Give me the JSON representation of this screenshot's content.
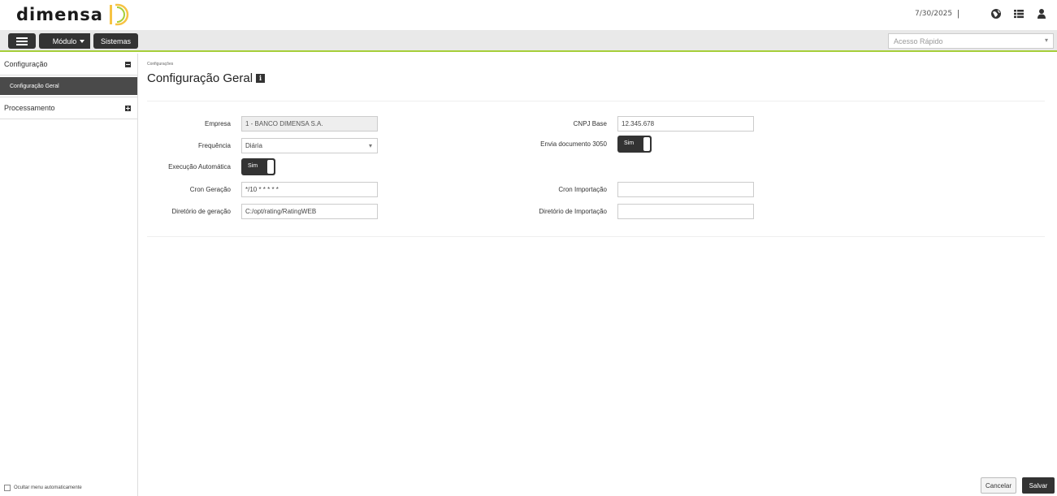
{
  "header": {
    "logo_text": "DIMENSA",
    "date": "7/30/2025",
    "separator": "|",
    "icons": [
      "globe-icon",
      "list-icon",
      "user-icon"
    ]
  },
  "toolbar": {
    "modulo_label": "Módulo",
    "sistemas_label": "Sistemas",
    "quick_access_placeholder": "Acesso Rápido"
  },
  "sidebar": {
    "groups": [
      {
        "label": "Configuração",
        "expanded": true,
        "items": [
          {
            "label": "Configuração Geral",
            "active": true
          }
        ]
      },
      {
        "label": "Processamento",
        "expanded": false,
        "items": []
      }
    ],
    "footer_label": "Ocultar menu automaticamente"
  },
  "main": {
    "breadcrumb": "Configurações",
    "title": "Configuração Geral",
    "form": {
      "empresa": {
        "label": "Empresa",
        "value": "1 - BANCO DIMENSA S.A."
      },
      "cnpj_base": {
        "label": "CNPJ Base",
        "value": "12.345.678"
      },
      "frequencia": {
        "label": "Frequência",
        "value": "Diária"
      },
      "envia_documento": {
        "label": "Envia documento 3050",
        "value": "Sim"
      },
      "execucao_automatica": {
        "label": "Execução Automática",
        "value": "Sim"
      },
      "cron_geracao": {
        "label": "Cron Geração",
        "value": "*/10 * * * * *"
      },
      "cron_importacao": {
        "label": "Cron Importação",
        "value": ""
      },
      "diretorio_geracao": {
        "label": "Diretório de geração",
        "value": "C:/opt/rating/RatingWEB"
      },
      "diretorio_importacao": {
        "label": "Diretório de Importação",
        "value": ""
      }
    },
    "buttons": {
      "cancel": "Cancelar",
      "save": "Salvar"
    }
  },
  "colors": {
    "accent": "#a6ce39",
    "dark": "#333333"
  }
}
